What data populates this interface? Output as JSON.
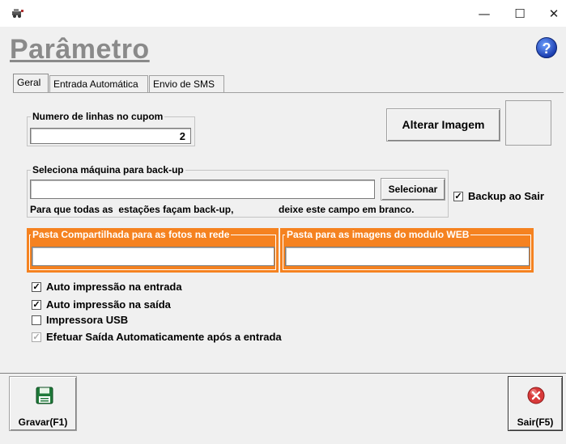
{
  "window": {
    "minimize_glyph": "—",
    "maximize_glyph": "☐",
    "close_glyph": "✕",
    "app_icon": "app-icon"
  },
  "heading": "Parâmetro",
  "help_glyph": "?",
  "tabs": [
    {
      "label": "Geral",
      "active": true
    },
    {
      "label": "Entrada Automática",
      "active": false
    },
    {
      "label": "Envio de SMS",
      "active": false
    }
  ],
  "linhas_cupom": {
    "label": "Numero de linhas no cupom",
    "value": "2"
  },
  "alterar_imagem_label": "Alterar Imagem",
  "backup": {
    "label": "Seleciona máquina para back-up",
    "value": "",
    "select_label": "Selecionar",
    "hint_left": "Para que todas as  estações façam back-up,",
    "hint_right": "deixe este campo em branco.",
    "backup_ao_sair_label": "Backup ao Sair",
    "backup_ao_sair_checked": true
  },
  "pasta_fotos": {
    "label": "Pasta Compartilhada para as fotos na rede",
    "value": ""
  },
  "pasta_web": {
    "label": "Pasta para as imagens do modulo WEB",
    "value": ""
  },
  "options": [
    {
      "label": "Auto impressão na entrada",
      "checked": true,
      "enabled": true
    },
    {
      "label": "Auto impressão na saída",
      "checked": true,
      "enabled": true
    },
    {
      "label": "Impressora USB",
      "checked": false,
      "enabled": true
    },
    {
      "label": "Efetuar Saída Automaticamente após a entrada",
      "checked": true,
      "enabled": false
    }
  ],
  "gravar_label": "Gravar(F1)",
  "sair_label": "Sair(F5)",
  "colors": {
    "orange": "#f58220",
    "heading_gray": "#8a8a8a"
  }
}
